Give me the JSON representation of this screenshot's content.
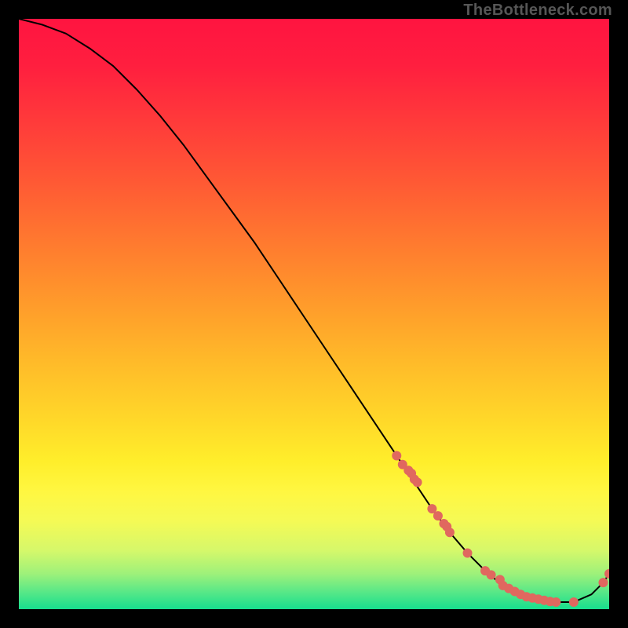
{
  "watermark": "TheBottleneck.com",
  "chart_data": {
    "type": "line",
    "title": "",
    "xlabel": "",
    "ylabel": "",
    "xlim": [
      0,
      100
    ],
    "ylim": [
      0,
      100
    ],
    "grid": false,
    "series": [
      {
        "name": "curve",
        "x": [
          0,
          4,
          8,
          12,
          16,
          20,
          24,
          28,
          32,
          36,
          40,
          44,
          48,
          52,
          56,
          60,
          64,
          67,
          70,
          73,
          76,
          79,
          82,
          85,
          88,
          91,
          94,
          97,
          99,
          100
        ],
        "y": [
          100,
          99,
          97.5,
          95,
          92,
          88,
          83.5,
          78.5,
          73,
          67.5,
          62,
          56,
          50,
          44,
          38,
          32,
          26,
          21.5,
          17,
          13,
          9.5,
          6.5,
          4,
          2.5,
          1.7,
          1.2,
          1.2,
          2.5,
          4.5,
          6
        ],
        "stroke": "#000000",
        "stroke_width": 2
      }
    ],
    "markers": {
      "name": "points",
      "color": "#e0685f",
      "radius": 6,
      "x": [
        64,
        65,
        66,
        66.5,
        67,
        67.5,
        70,
        71,
        72,
        72.5,
        73,
        76,
        79,
        80,
        81.5,
        82,
        83,
        84,
        85,
        86,
        87,
        88,
        89,
        90,
        91,
        94,
        99,
        100
      ],
      "y": [
        26,
        24.5,
        23.5,
        23,
        22,
        21.5,
        17,
        15.8,
        14.5,
        14,
        13,
        9.5,
        6.5,
        5.8,
        5,
        4,
        3.5,
        3,
        2.5,
        2.1,
        1.9,
        1.7,
        1.5,
        1.3,
        1.2,
        1.2,
        4.5,
        6
      ]
    },
    "background_gradient": {
      "stops": [
        {
          "offset": 0.0,
          "color": "#ff1440"
        },
        {
          "offset": 0.08,
          "color": "#ff1f3f"
        },
        {
          "offset": 0.18,
          "color": "#ff3c3a"
        },
        {
          "offset": 0.28,
          "color": "#ff5a34"
        },
        {
          "offset": 0.38,
          "color": "#ff7a2f"
        },
        {
          "offset": 0.48,
          "color": "#ff9a2b"
        },
        {
          "offset": 0.58,
          "color": "#ffba29"
        },
        {
          "offset": 0.68,
          "color": "#ffd829"
        },
        {
          "offset": 0.75,
          "color": "#ffee2b"
        },
        {
          "offset": 0.8,
          "color": "#fff741"
        },
        {
          "offset": 0.85,
          "color": "#f5fa55"
        },
        {
          "offset": 0.9,
          "color": "#d6f86a"
        },
        {
          "offset": 0.94,
          "color": "#9ef17a"
        },
        {
          "offset": 0.97,
          "color": "#5ae887"
        },
        {
          "offset": 1.0,
          "color": "#17df8e"
        }
      ]
    }
  }
}
